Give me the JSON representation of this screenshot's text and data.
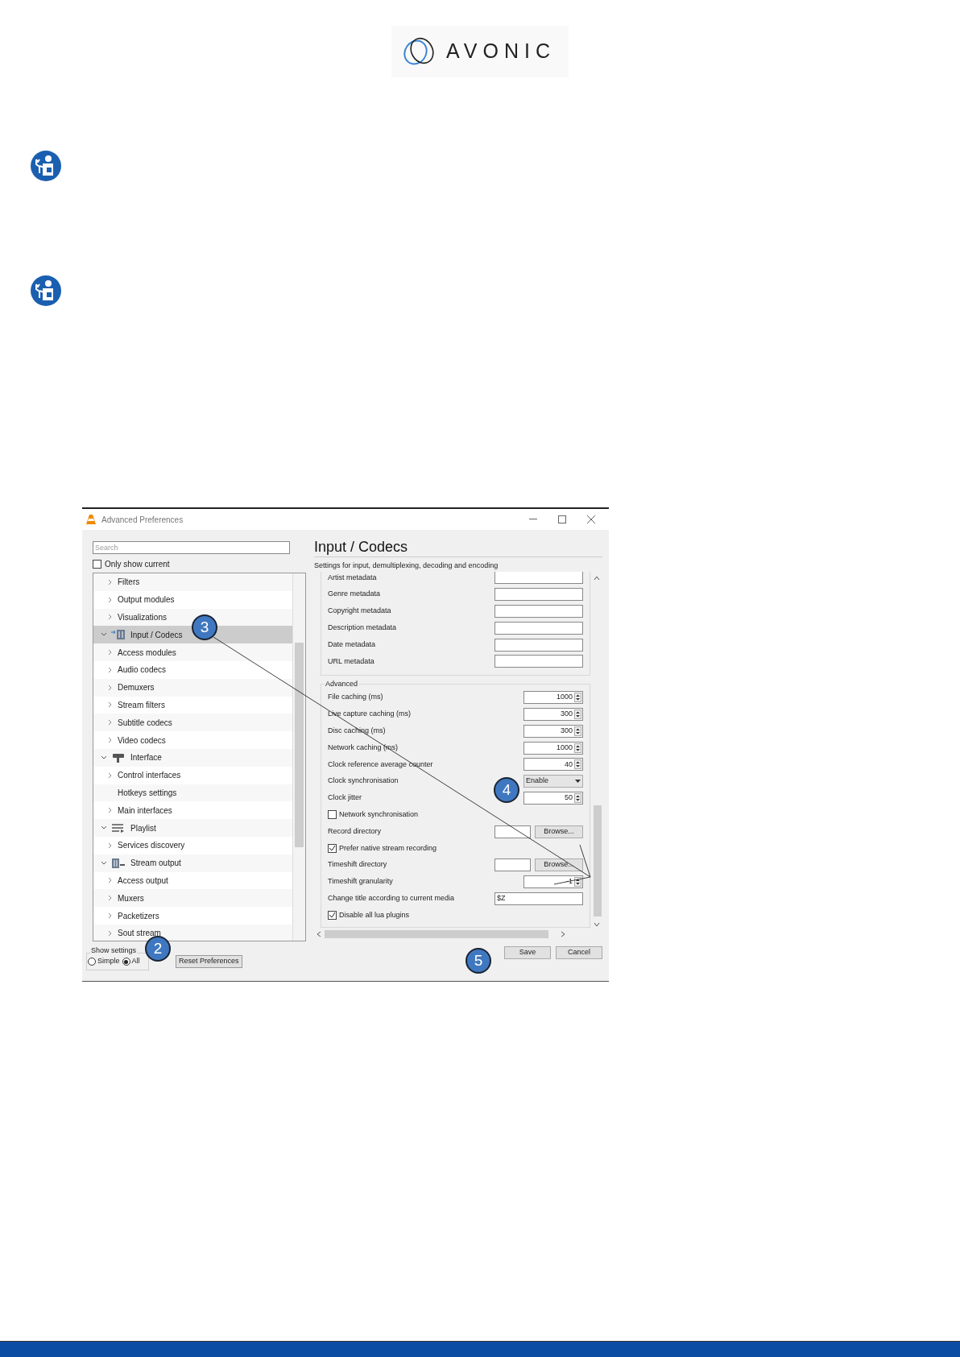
{
  "logo": {
    "text": "AVONIC"
  },
  "window": {
    "title": "Advanced Preferences",
    "search": {
      "placeholder": "Search"
    },
    "only_show_current": {
      "label": "Only show current",
      "checked": false
    },
    "tree": [
      {
        "kind": "module",
        "label": "Filters",
        "expanded": false,
        "selected": false
      },
      {
        "kind": "module",
        "label": "Output modules",
        "expanded": false,
        "selected": false
      },
      {
        "kind": "module",
        "label": "Visualizations",
        "expanded": false,
        "selected": false
      },
      {
        "kind": "category",
        "label": "Input / Codecs",
        "expanded": true,
        "selected": true,
        "children": [
          {
            "kind": "module",
            "label": "Access modules",
            "expanded": false,
            "selected": false
          },
          {
            "kind": "module",
            "label": "Audio codecs",
            "expanded": false,
            "selected": false
          },
          {
            "kind": "module",
            "label": "Demuxers",
            "expanded": false,
            "selected": false
          },
          {
            "kind": "module",
            "label": "Stream filters",
            "expanded": false,
            "selected": false
          },
          {
            "kind": "module",
            "label": "Subtitle codecs",
            "expanded": false,
            "selected": false
          },
          {
            "kind": "module",
            "label": "Video codecs",
            "expanded": false,
            "selected": false
          }
        ]
      },
      {
        "kind": "category",
        "label": "Interface",
        "expanded": true,
        "selected": false,
        "children": [
          {
            "kind": "module",
            "label": "Control interfaces",
            "expanded": false,
            "selected": false
          },
          {
            "kind": "leaf",
            "label": "Hotkeys settings",
            "selected": false
          },
          {
            "kind": "module",
            "label": "Main interfaces",
            "expanded": false,
            "selected": false
          }
        ]
      },
      {
        "kind": "category",
        "label": "Playlist",
        "expanded": true,
        "selected": false,
        "children": [
          {
            "kind": "module",
            "label": "Services discovery",
            "expanded": false,
            "selected": false
          }
        ]
      },
      {
        "kind": "category",
        "label": "Stream output",
        "expanded": true,
        "selected": false,
        "children": [
          {
            "kind": "module",
            "label": "Access output",
            "expanded": false,
            "selected": false
          },
          {
            "kind": "module",
            "label": "Muxers",
            "expanded": false,
            "selected": false
          },
          {
            "kind": "module",
            "label": "Packetizers",
            "expanded": false,
            "selected": false
          },
          {
            "kind": "module",
            "label": "Sout stream",
            "expanded": false,
            "selected": false
          }
        ]
      }
    ],
    "show_settings": {
      "label": "Show settings",
      "options": [
        {
          "label": "Simple",
          "selected": false
        },
        {
          "label": "All",
          "selected": true
        }
      ]
    },
    "reset_button": "Reset Preferences",
    "heading": "Input / Codecs",
    "subheading": "Settings for input, demultiplexing, decoding and encoding",
    "groups": [
      {
        "rows": [
          {
            "kind": "text",
            "label": "Artist metadata"
          },
          {
            "kind": "text",
            "label": "Genre metadata"
          },
          {
            "kind": "text",
            "label": "Copyright metadata"
          },
          {
            "kind": "text",
            "label": "Description metadata"
          },
          {
            "kind": "text",
            "label": "Date metadata"
          },
          {
            "kind": "text",
            "label": "URL metadata"
          }
        ]
      },
      {
        "title": "Advanced",
        "rows": [
          {
            "kind": "spin",
            "label": "File caching (ms)",
            "value": "1000"
          },
          {
            "kind": "spin",
            "label": "Live capture caching (ms)",
            "value": "300"
          },
          {
            "kind": "spin",
            "label": "Disc caching (ms)",
            "value": "300"
          },
          {
            "kind": "spin",
            "label": "Network caching (ms)",
            "value": "1000"
          },
          {
            "kind": "spin",
            "label": "Clock reference average counter",
            "value": "40"
          },
          {
            "kind": "dropdown",
            "label": "Clock synchronisation",
            "value": "Enable"
          },
          {
            "kind": "spin",
            "label": "Clock jitter",
            "value": "50"
          },
          {
            "kind": "checkbox",
            "label": "Network synchronisation",
            "checked": false
          },
          {
            "kind": "path",
            "label": "Record directory",
            "button": "Browse..."
          },
          {
            "kind": "checkbox",
            "label": "Prefer native stream recording",
            "checked": true
          },
          {
            "kind": "path",
            "label": "Timeshift directory",
            "button": "Browse..."
          },
          {
            "kind": "spin",
            "label": "Timeshift granularity",
            "value": "-1"
          },
          {
            "kind": "wide",
            "label": "Change title according to current media",
            "value": "$Z"
          },
          {
            "kind": "checkbox",
            "label": "Disable all lua plugins",
            "checked": true
          }
        ]
      }
    ],
    "buttons": [
      "Save",
      "Cancel"
    ]
  },
  "callouts": [
    {
      "number": "3"
    },
    {
      "number": "4"
    },
    {
      "number": "5"
    },
    {
      "number": "2"
    }
  ]
}
